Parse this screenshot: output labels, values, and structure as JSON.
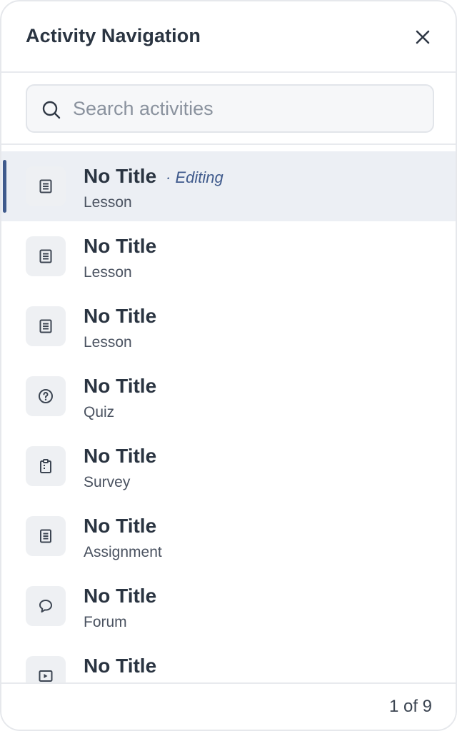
{
  "header": {
    "title": "Activity Navigation"
  },
  "search": {
    "placeholder": "Search activities",
    "value": ""
  },
  "items": [
    {
      "title": "No Title",
      "status": "· Editing",
      "type": "Lesson",
      "icon": "document-icon",
      "active": true
    },
    {
      "title": "No Title",
      "status": "",
      "type": "Lesson",
      "icon": "document-icon",
      "active": false
    },
    {
      "title": "No Title",
      "status": "",
      "type": "Lesson",
      "icon": "document-icon",
      "active": false
    },
    {
      "title": "No Title",
      "status": "",
      "type": "Quiz",
      "icon": "question-circle-icon",
      "active": false
    },
    {
      "title": "No Title",
      "status": "",
      "type": "Survey",
      "icon": "clipboard-icon",
      "active": false
    },
    {
      "title": "No Title",
      "status": "",
      "type": "Assignment",
      "icon": "assignment-icon",
      "active": false
    },
    {
      "title": "No Title",
      "status": "",
      "type": "Forum",
      "icon": "speech-bubble-icon",
      "active": false
    },
    {
      "title": "No Title",
      "status": "",
      "type": "",
      "icon": "video-icon",
      "active": false
    }
  ],
  "footer": {
    "page_count": "1 of 9"
  },
  "colors": {
    "accent": "#3f5a8c",
    "text": "#2a3441",
    "active_bg": "#eceff4"
  }
}
